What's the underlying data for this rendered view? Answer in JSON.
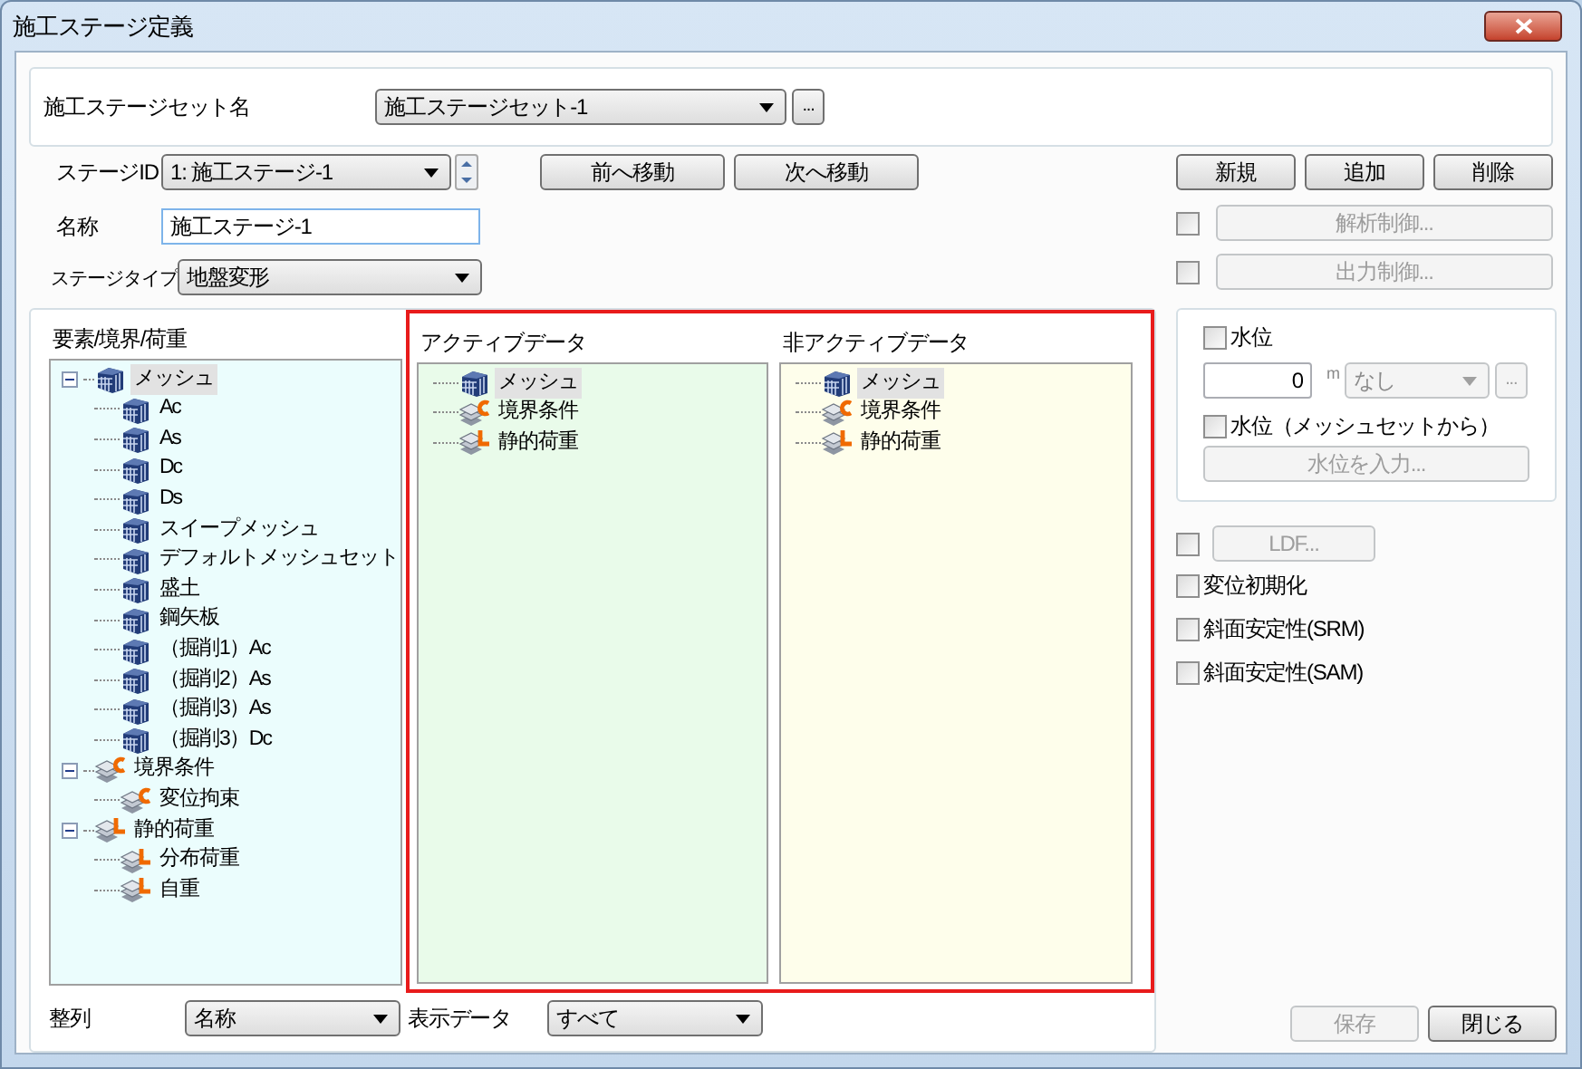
{
  "window": {
    "title": "施工ステージ定義"
  },
  "stage_set": {
    "label": "施工ステージセット名",
    "value": "施工ステージセット-1",
    "browse": "..."
  },
  "stage_id": {
    "label": "ステージID",
    "value": "1: 施工ステージ-1"
  },
  "nav_buttons": [
    {
      "label": "前へ移動"
    },
    {
      "label": "次へ移動"
    }
  ],
  "action_buttons": [
    {
      "label": "新規",
      "disabled": false
    },
    {
      "label": "追加",
      "disabled": false
    },
    {
      "label": "削除",
      "disabled": false
    }
  ],
  "name": {
    "label": "名称",
    "value": "施工ステージ-1"
  },
  "stage_type": {
    "label": "ステージタイプ",
    "value": "地盤変形"
  },
  "control_options": [
    {
      "checked": false,
      "label": "解析制御...",
      "disabled": true
    },
    {
      "checked": false,
      "label": "出力制御...",
      "disabled": true
    }
  ],
  "panels": [
    {
      "title": "要素/境界/荷重",
      "color": "#ebfdfd",
      "tree": [
        {
          "kind": "mesh",
          "label": "メッシュ",
          "selected": true,
          "expanded": true,
          "children": [
            {
              "kind": "mesh",
              "label": "Ac",
              "selected": false
            },
            {
              "kind": "mesh",
              "label": "As",
              "selected": false
            },
            {
              "kind": "mesh",
              "label": "Dc",
              "selected": false
            },
            {
              "kind": "mesh",
              "label": "Ds",
              "selected": false
            },
            {
              "kind": "mesh",
              "label": "スイープメッシュ",
              "selected": false
            },
            {
              "kind": "mesh",
              "label": "デフォルトメッシュセット",
              "selected": false
            },
            {
              "kind": "mesh",
              "label": "盛土",
              "selected": false
            },
            {
              "kind": "mesh",
              "label": "鋼矢板",
              "selected": false
            },
            {
              "kind": "mesh",
              "label": "（掘削1）Ac",
              "selected": false
            },
            {
              "kind": "mesh",
              "label": "（掘削2）As",
              "selected": false
            },
            {
              "kind": "mesh",
              "label": "（掘削3）As",
              "selected": false
            },
            {
              "kind": "mesh",
              "label": "（掘削3）Dc",
              "selected": false
            }
          ]
        },
        {
          "kind": "boundary",
          "label": "境界条件",
          "selected": false,
          "expanded": true,
          "children": [
            {
              "kind": "boundary",
              "label": "変位拘束",
              "selected": false
            }
          ]
        },
        {
          "kind": "load",
          "label": "静的荷重",
          "selected": false,
          "expanded": true,
          "children": [
            {
              "kind": "load",
              "label": "分布荷重",
              "selected": false
            },
            {
              "kind": "load",
              "label": "自重",
              "selected": false
            }
          ]
        }
      ]
    },
    {
      "title": "アクティブデータ",
      "color": "#e9fbea",
      "tree": [
        {
          "kind": "mesh",
          "label": "メッシュ",
          "selected": true
        },
        {
          "kind": "boundary",
          "label": "境界条件",
          "selected": false
        },
        {
          "kind": "load",
          "label": "静的荷重",
          "selected": false
        }
      ]
    },
    {
      "title": "非アクティブデータ",
      "color": "#fefeeb",
      "tree": [
        {
          "kind": "mesh",
          "label": "メッシュ",
          "selected": true
        },
        {
          "kind": "boundary",
          "label": "境界条件",
          "selected": false
        },
        {
          "kind": "load",
          "label": "静的荷重",
          "selected": false
        }
      ]
    }
  ],
  "sort": {
    "label": "整列",
    "value": "名称"
  },
  "display": {
    "label": "表示データ",
    "value": "すべて"
  },
  "water_level": {
    "checked": false,
    "label": "水位",
    "value": "0",
    "unit": "m",
    "select": "なし",
    "browse": "...",
    "from_mesh": {
      "checked": false,
      "label": "水位（メッシュセットから）"
    },
    "input_button": {
      "label": "水位を入力...",
      "disabled": true
    }
  },
  "ldf": {
    "checked": false,
    "label": "LDF...",
    "disabled": true
  },
  "options": [
    {
      "label": "変位初期化",
      "checked": false
    },
    {
      "label": "斜面安定性(SRM)",
      "checked": false
    },
    {
      "label": "斜面安定性(SAM)",
      "checked": false
    }
  ],
  "footer_buttons": [
    {
      "label": "保存",
      "disabled": true
    },
    {
      "label": "閉じる",
      "disabled": false
    }
  ]
}
